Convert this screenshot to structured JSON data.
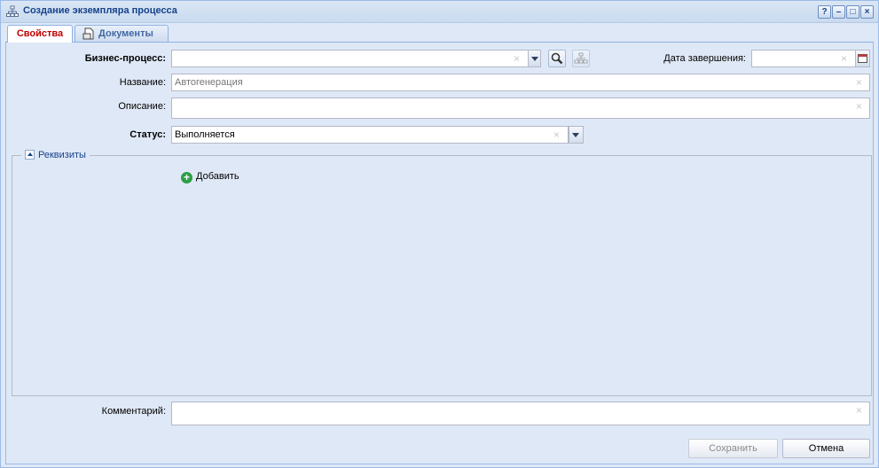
{
  "window": {
    "title": "Создание экземпляра процесса",
    "tools": {
      "help": "?",
      "minimize": "–",
      "maximize": "□",
      "close": "×"
    }
  },
  "tabs": [
    {
      "label": "Свойства",
      "active": true
    },
    {
      "label": "Документы",
      "active": false
    }
  ],
  "form": {
    "business_process": {
      "label": "Бизнес-процесс:",
      "value": ""
    },
    "end_date": {
      "label": "Дата завершения:",
      "value": ""
    },
    "name": {
      "label": "Название:",
      "value": "Автогенерация"
    },
    "description": {
      "label": "Описание:",
      "value": ""
    },
    "status": {
      "label": "Статус:",
      "value": "Выполняется"
    },
    "requisites": {
      "legend": "Реквизиты",
      "add_label": "Добавить"
    },
    "comment": {
      "label": "Комментарий:",
      "value": ""
    }
  },
  "buttons": {
    "save": "Сохранить",
    "cancel": "Отмена"
  },
  "icons": {
    "title": "process-tree-icon",
    "search": "magnifier-icon",
    "tree": "hierarchy-icon",
    "calendar": "calendar-icon",
    "add": "plus-circle-icon"
  }
}
